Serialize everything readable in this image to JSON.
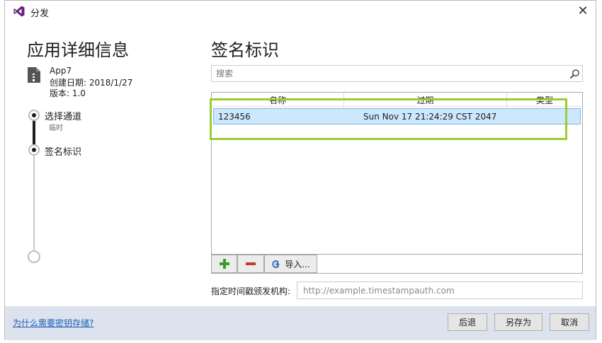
{
  "window": {
    "title": "分发"
  },
  "left": {
    "heading": "应用详细信息",
    "app": {
      "name": "App7",
      "created": "创建日期: 2018/1/27",
      "version": "版本: 1.0"
    },
    "steps": [
      {
        "label": "选择通道",
        "sublabel": "临时",
        "state": "done"
      },
      {
        "label": "签名标识",
        "sublabel": "",
        "state": "current"
      },
      {
        "label": "",
        "sublabel": "",
        "state": "pending"
      }
    ]
  },
  "right": {
    "heading": "签名标识",
    "search": {
      "placeholder": "搜索",
      "value": ""
    },
    "table": {
      "columns": [
        "名称",
        "过期",
        "类型"
      ],
      "rows": [
        {
          "name": "123456",
          "expires": "Sun Nov 17 21:24:29 CST 2047",
          "type": "",
          "selected": true
        }
      ]
    },
    "toolbar": {
      "add_label": "+",
      "remove_label": "−",
      "import_label": "导入..."
    },
    "timestamp": {
      "label": "指定时间戳颁发机构:",
      "placeholder": "http://example.timestampauth.com",
      "value": ""
    }
  },
  "footer": {
    "help_link": "为什么需要密钥存储?",
    "back_label": "后退",
    "save_as_label": "另存为",
    "cancel_label": "取消"
  },
  "colors": {
    "accent_link": "#1a5fb4",
    "selection": "#cce8ff",
    "highlight_annotation": "#9acd32",
    "footer_bg": "#dde3ee",
    "vs_purple": "#68217a",
    "add_green": "#3a9a2a",
    "remove_red": "#c0392b"
  },
  "icons": {
    "app_logo": "visual-studio-logo",
    "close": "close-icon",
    "file": "zip-file-icon",
    "search": "search-icon",
    "add": "plus-icon",
    "remove": "minus-icon",
    "import": "import-icon"
  }
}
